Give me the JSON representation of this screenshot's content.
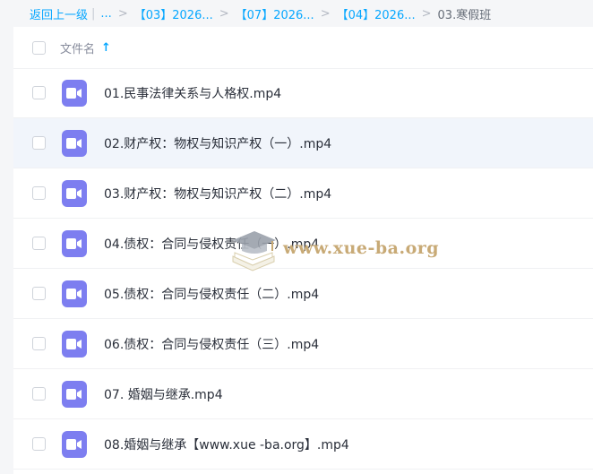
{
  "breadcrumb": {
    "back_label": "返回上一级",
    "ellipsis": "...",
    "crumbs": [
      "【03】2026...",
      "【07】2026...",
      "【04】2026..."
    ],
    "current": "03.寒假班"
  },
  "list_header": {
    "column_name": "文件名",
    "sort_icon": "arrow-up-icon"
  },
  "files": [
    {
      "name": "01.民事法律关系与人格权.mp4",
      "icon": "video-file-icon"
    },
    {
      "name": "02.财产权：物权与知识产权（一）.mp4",
      "icon": "video-file-icon"
    },
    {
      "name": "03.财产权：物权与知识产权（二）.mp4",
      "icon": "video-file-icon"
    },
    {
      "name": "04.债权：合同与侵权责任（一）.mp4",
      "icon": "video-file-icon"
    },
    {
      "name": "05.债权：合同与侵权责任（二）.mp4",
      "icon": "video-file-icon"
    },
    {
      "name": "06.债权：合同与侵权责任（三）.mp4",
      "icon": "video-file-icon"
    },
    {
      "name": "07. 婚姻与继承.mp4",
      "icon": "video-file-icon"
    },
    {
      "name": "08.婚姻与继承【www.xue -ba.org】.mp4",
      "icon": "video-file-icon"
    }
  ],
  "watermark": {
    "text": "www.xue-ba.org"
  },
  "colors": {
    "accent": "#06a7ff",
    "video_icon": "#7d7ef0",
    "row_hover": "#f1f5fb",
    "watermark": "#c8aa76"
  }
}
